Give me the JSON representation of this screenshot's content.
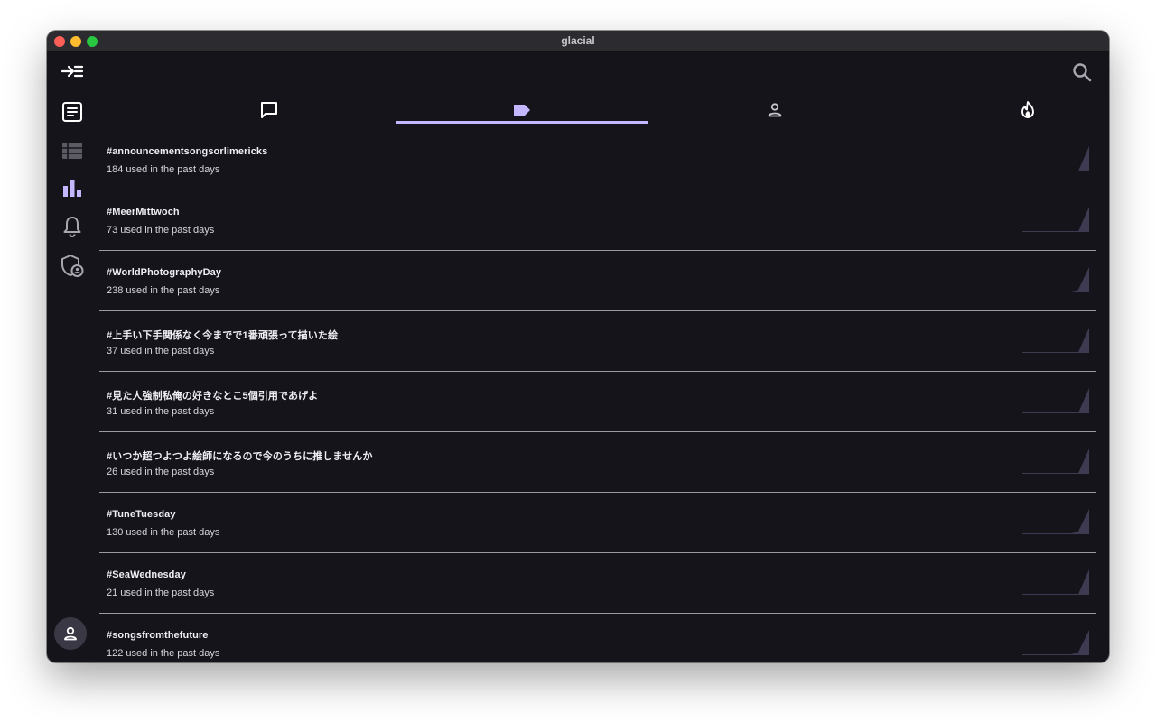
{
  "window": {
    "title": "glacial"
  },
  "sidebar": {
    "items": [
      {
        "name": "collapse-menu-icon"
      },
      {
        "name": "timeline-icon"
      },
      {
        "name": "lists-icon"
      },
      {
        "name": "trends-icon",
        "active": true
      },
      {
        "name": "notifications-icon"
      },
      {
        "name": "privacy-shield-icon"
      }
    ],
    "avatar": {
      "name": "user-avatar"
    }
  },
  "toolbar": {
    "search_icon": "search-icon"
  },
  "tabs": [
    {
      "name": "posts",
      "icon": "speech-bubble-icon",
      "active": false
    },
    {
      "name": "tags",
      "icon": "tag-icon",
      "active": true
    },
    {
      "name": "people",
      "icon": "person-icon",
      "active": false
    },
    {
      "name": "trending",
      "icon": "flame-icon",
      "active": false
    }
  ],
  "colors": {
    "accent": "#c4b7ff",
    "background": "#16141b",
    "sparkline": "#3e3a52"
  },
  "trends": [
    {
      "tag": "#announcementsongsorlimericks",
      "usage": "184 used in the past days",
      "history": [
        0,
        0,
        0,
        0,
        0,
        0,
        1
      ]
    },
    {
      "tag": "#MeerMittwoch",
      "usage": "73 used in the past days",
      "history": [
        0,
        0,
        0,
        0,
        0,
        0,
        1
      ]
    },
    {
      "tag": "#WorldPhotographyDay",
      "usage": "238 used in the past days",
      "history": [
        0,
        0,
        0,
        0,
        0,
        0.1,
        1
      ]
    },
    {
      "tag": "#上手い下手関係なく今までで1番頑張って描いた絵",
      "usage": "37 used in the past days",
      "history": [
        0,
        0,
        0,
        0,
        0,
        0,
        1
      ]
    },
    {
      "tag": "#見た人強制私俺の好きなとこ5個引用であげよ",
      "usage": "31 used in the past days",
      "history": [
        0,
        0,
        0,
        0,
        0,
        0,
        1
      ]
    },
    {
      "tag": "#いつか超つよつよ絵師になるので今のうちに推しませんか",
      "usage": "26 used in the past days",
      "history": [
        0,
        0,
        0,
        0,
        0,
        0,
        1
      ]
    },
    {
      "tag": "#TuneTuesday",
      "usage": "130 used in the past days",
      "history": [
        0,
        0,
        0,
        0,
        0,
        0.1,
        1
      ]
    },
    {
      "tag": "#SeaWednesday",
      "usage": "21 used in the past days",
      "history": [
        0,
        0,
        0,
        0,
        0,
        0,
        1
      ]
    },
    {
      "tag": "#songsfromthefuture",
      "usage": "122 used in the past days",
      "history": [
        0,
        0,
        0,
        0,
        0,
        0.1,
        1
      ]
    }
  ]
}
